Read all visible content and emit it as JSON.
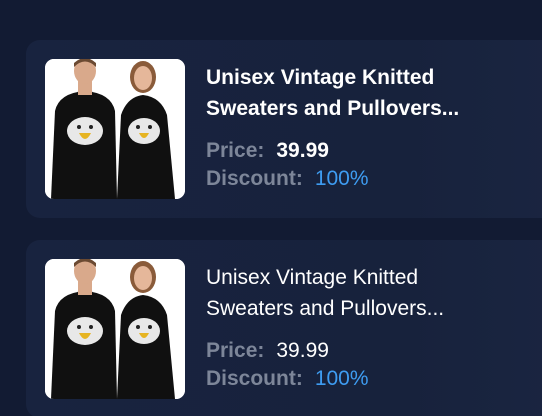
{
  "products": [
    {
      "title_line1": "Unisex Vintage Knitted",
      "title_line2": "Sweaters and Pullovers...",
      "price_label": "Price:",
      "price_value": "39.99",
      "discount_label": "Discount:",
      "discount_value": "100%",
      "image_icon": "product-photo-icon"
    },
    {
      "title_line1": "Unisex Vintage Knitted",
      "title_line2": "Sweaters and Pullovers...",
      "price_label": "Price:",
      "price_value": "39.99",
      "discount_label": "Discount:",
      "discount_value": "100%",
      "image_icon": "product-photo-icon"
    }
  ],
  "colors": {
    "background": "#121b33",
    "card": "#18233f",
    "label": "#7d8699",
    "discount": "#3e9cf1"
  }
}
